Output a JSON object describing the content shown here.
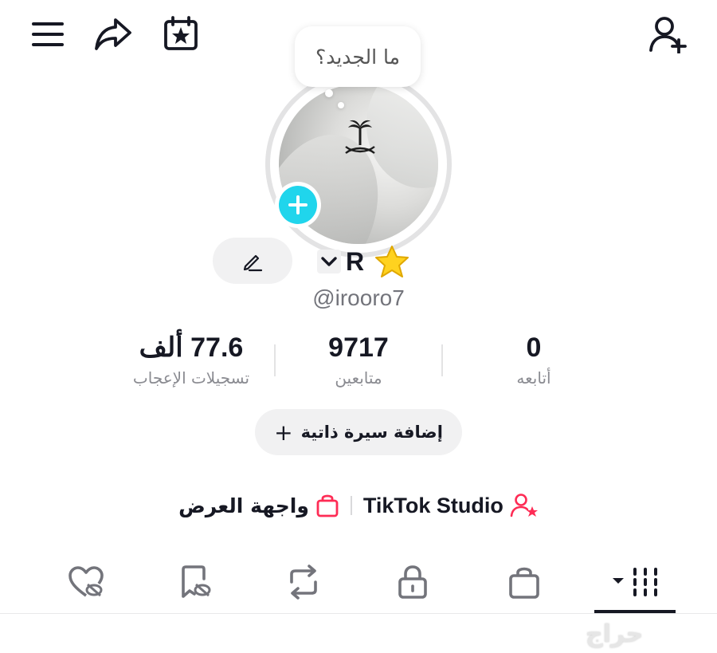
{
  "header": {
    "menu_icon": "hamburger-menu-icon",
    "share_icon": "share-arrow-icon",
    "calendar_icon": "calendar-star-icon",
    "add_friend_icon": "add-user-icon"
  },
  "profile": {
    "bubble_text": "ما الجديد؟",
    "name": "R",
    "handle": "@irooro7",
    "name_emoji": "star-icon",
    "edit_icon": "pencil-icon"
  },
  "stats": [
    {
      "value": "0",
      "label": "أتابعه"
    },
    {
      "value": "9717",
      "label": "متابعين"
    },
    {
      "value": "77.6 ألف",
      "label": "تسجيلات الإعجاب"
    }
  ],
  "bio_button": {
    "label": "إضافة سيرة ذاتية",
    "icon": "+"
  },
  "links": {
    "studio_label": "TikTok Studio",
    "showcase_label": "واجهة العرض",
    "accent_color": "#fe2c55"
  },
  "tabs": [
    {
      "name": "videos-grid",
      "active": true
    },
    {
      "name": "shop"
    },
    {
      "name": "private"
    },
    {
      "name": "reposts"
    },
    {
      "name": "favorites"
    },
    {
      "name": "liked"
    }
  ],
  "watermark": "حراج",
  "colors": {
    "accent_plus": "#20d5ec",
    "text": "#161823",
    "muted": "#8a8b91"
  }
}
